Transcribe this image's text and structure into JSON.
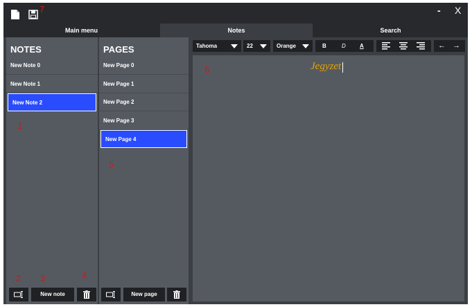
{
  "title_bar": {
    "icons": [
      "new-file-icon",
      "save-icon"
    ],
    "minimize_label": "-",
    "close_label": "X"
  },
  "annotations": [
    "1",
    "2",
    "3",
    "4",
    "5",
    "6",
    "7"
  ],
  "tabs": [
    {
      "label": "Main menu"
    },
    {
      "label": "Notes"
    },
    {
      "label": "Search"
    }
  ],
  "notes": {
    "header": "NOTES",
    "items": [
      "New Note 0",
      "New Note 1",
      "New Note 2"
    ],
    "selected_index": 2,
    "buttons": {
      "rename_icon": "rename-icon",
      "new_label": "New note",
      "delete_icon": "trash-icon"
    }
  },
  "pages": {
    "header": "PAGES",
    "items": [
      "New Page 0",
      "New Page 1",
      "New Page 2",
      "New Page 3",
      "New Page 4"
    ],
    "selected_index": 4,
    "buttons": {
      "rename_icon": "rename-icon",
      "new_label": "New page",
      "delete_icon": "trash-icon"
    }
  },
  "toolbar": {
    "font": "Tahoma",
    "size": "22",
    "color": "Orange",
    "bold": "B",
    "italic": "D",
    "underline": "A",
    "undo": "←",
    "redo": "→"
  },
  "editor": {
    "text": "Jegyzet",
    "text_color": "#e6a300"
  },
  "colors": {
    "selection": "#2a4cff",
    "panel": "#555a61",
    "titlebar": "#27292c",
    "annotation": "#d01818"
  }
}
